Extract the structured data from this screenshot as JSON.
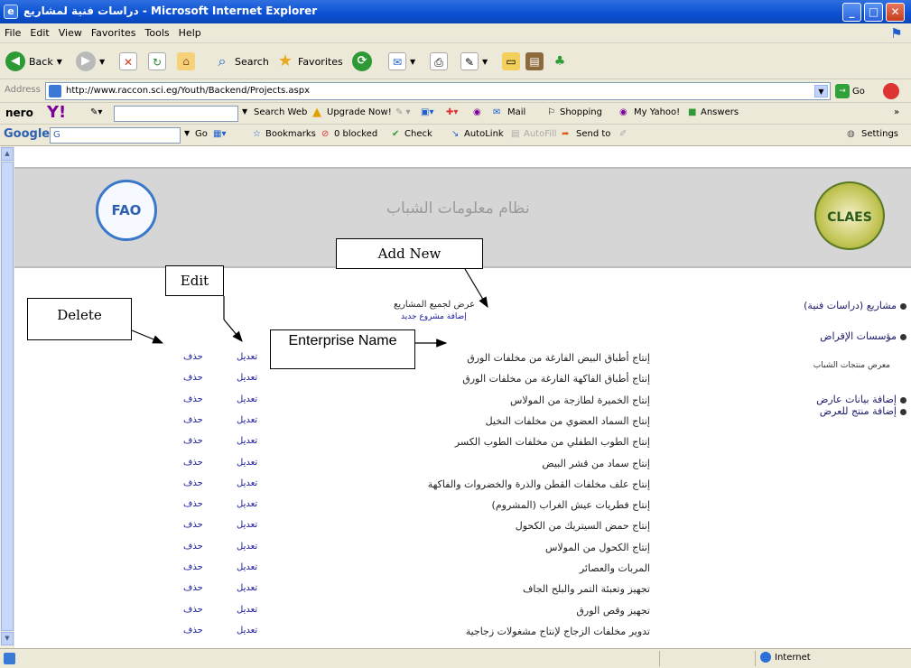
{
  "window": {
    "title": "دراسات فنية لمشاريع - Microsoft Internet Explorer"
  },
  "menu": [
    "File",
    "Edit",
    "View",
    "Favorites",
    "Tools",
    "Help"
  ],
  "toolbar": {
    "back": "Back",
    "search": "Search",
    "favorites": "Favorites"
  },
  "address": {
    "label": "Address",
    "url": "http://www.raccon.sci.eg/Youth/Backend/Projects.aspx",
    "go": "Go"
  },
  "yahoo": {
    "nero": "nero",
    "search_web": "Search Web",
    "upgrade": "Upgrade Now!",
    "mail": "Mail",
    "shopping": "Shopping",
    "my_yahoo": "My Yahoo!",
    "answers": "Answers"
  },
  "google": {
    "label": "Google",
    "field": "G",
    "go": "Go",
    "bookmarks": "Bookmarks",
    "blocked": "0 blocked",
    "check": "Check",
    "autolink": "AutoLink",
    "autofill": "AutoFill",
    "send_to": "Send to",
    "settings": "Settings"
  },
  "banner": {
    "system_name": "نظام معلومات الشباب",
    "fao_logo": "FAO",
    "claes_logo": "CLAES"
  },
  "sidebar": {
    "items": [
      {
        "label": "مشاريع (دراسات فنية)"
      },
      {
        "label": "مؤسسات الإقراض"
      },
      {
        "label": "معرض منتجات الشباب"
      },
      {
        "label": "إضافة بيانات عارض"
      },
      {
        "label": "إضافة منتج للعرض"
      }
    ]
  },
  "list": {
    "title": "عرض لجميع المشاريع",
    "add_new": "إضافة مشروع جديد",
    "delete_label": "حذف",
    "edit_label": "تعديل",
    "rows": [
      "إنتاج أطباق البيض الفارغة من مخلفات الورق",
      "إنتاج أطباق الفاكهة الفارغة من مخلفات الورق",
      "إنتاج الخميرة لطازجة من المولاس",
      "إنتاج السماد العضوي من مخلفات النخيل",
      "إنتاج الطوب الطفلي من مخلفات الطوب الكسر",
      "إنتاج سماد من قشر البيض",
      "إنتاج علف مخلفات القطن والذرة والخضروات والفاكهة",
      "إنتاج فطريات عيش الغراب (المشروم)",
      "إنتاج حمض السيتريك من الكحول",
      "إنتاج الكحول من المولاس",
      "المربات والعصائر",
      "تجهيز وتعبئة التمر والبلح الجاف",
      "تجهيز وقص الورق",
      "تدوير مخلفات الزجاج لإنتاج مشغولات زجاجية"
    ]
  },
  "annotations": {
    "add_new": "Add New",
    "edit": "Edit",
    "delete": "Delete",
    "enterprise_name": "Enterprise Name"
  },
  "status": {
    "zone": "Internet"
  }
}
